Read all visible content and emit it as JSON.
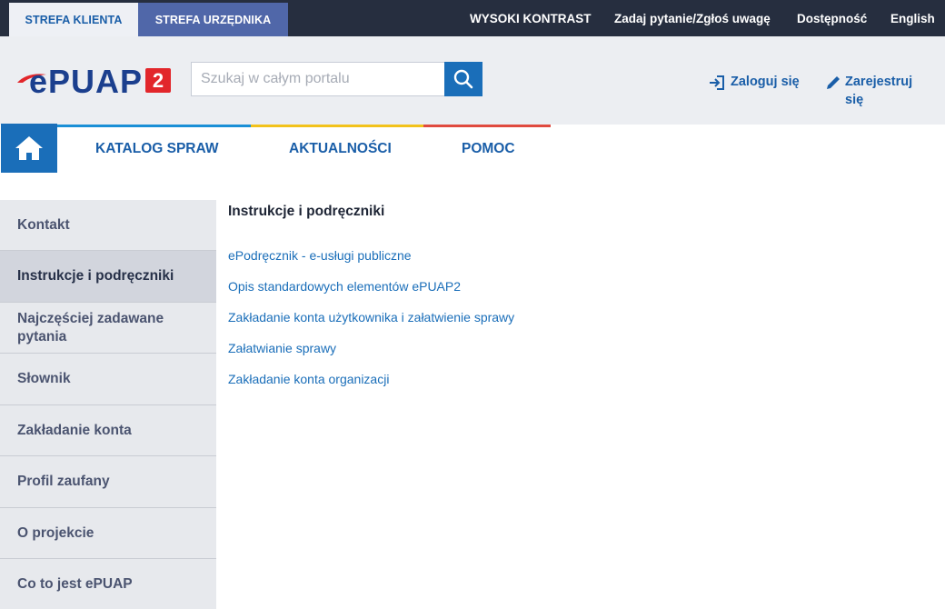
{
  "topbar": {
    "zone_client": "STREFA KLIENTA",
    "zone_official": "STREFA URZĘDNIKA",
    "high_contrast": "WYSOKI KONTRAST",
    "ask_question": "Zadaj pytanie/Zgłoś uwagę",
    "accessibility": "Dostępność",
    "language": "English"
  },
  "header": {
    "logo_text": "ePUAP",
    "logo_badge": "2",
    "search_placeholder": "Szukaj w całym portalu",
    "search_value": "",
    "login_label": "Zaloguj się",
    "register_label": "Zarejestruj się"
  },
  "nav": {
    "home_icon": "home-icon",
    "items": [
      "KATALOG SPRAW",
      "AKTUALNOŚCI",
      "POMOC"
    ],
    "stripe_colors": [
      "#1a8fd6",
      "#f2c21b",
      "#e04a3f"
    ]
  },
  "sidebar": {
    "items": [
      "Kontakt",
      "Instrukcje i podręczniki",
      "Najczęściej zadawane pytania",
      "Słownik",
      "Zakładanie konta",
      "Profil zaufany",
      "O projekcie",
      "Co to jest ePUAP"
    ],
    "active_index": 1
  },
  "content": {
    "title": "Instrukcje i podręczniki",
    "links": [
      "ePodręcznik - e-usługi publiczne",
      "Opis standardowych elementów ePUAP2",
      "Zakładanie konta użytkownika i załatwienie sprawy",
      "Załatwianie sprawy",
      "Zakładanie konta organizacji"
    ]
  },
  "colors": {
    "topbar_bg": "#262e3f",
    "accent_blue": "#1a6eb9",
    "logo_red": "#e2262b",
    "sidebar_bg": "#e7e9ed"
  }
}
